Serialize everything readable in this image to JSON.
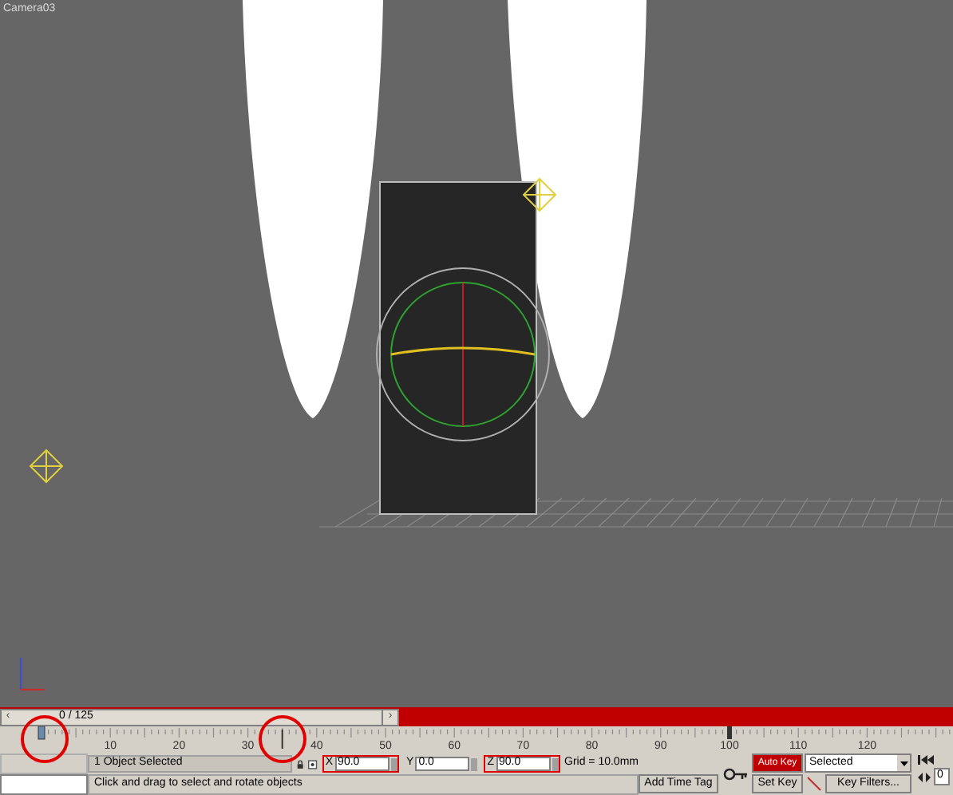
{
  "viewport": {
    "label": "Camera03"
  },
  "time_slider": {
    "text": "0 / 125",
    "level": 0,
    "prev": "‹",
    "next": "›"
  },
  "ruler": {
    "labels": [
      "10",
      "20",
      "30",
      "40",
      "50",
      "60",
      "70",
      "80",
      "90",
      "100",
      "110",
      "120"
    ]
  },
  "status": {
    "selection": "1 Object Selected",
    "prompt": "Click and drag to select and rotate objects"
  },
  "coords": [
    {
      "axis": "X",
      "value": "90.0",
      "highlighted": true
    },
    {
      "axis": "Y",
      "value": "0.0",
      "highlighted": false
    },
    {
      "axis": "Z",
      "value": "90.0",
      "highlighted": true
    }
  ],
  "grid": "Grid = 10.0mm",
  "add_time_tag": "Add Time Tag",
  "auto_key": {
    "label": "Auto Key",
    "on": true
  },
  "set_key": "Set Key",
  "key_mode": "Selected",
  "key_filters": "Key Filters...",
  "frame": "0"
}
